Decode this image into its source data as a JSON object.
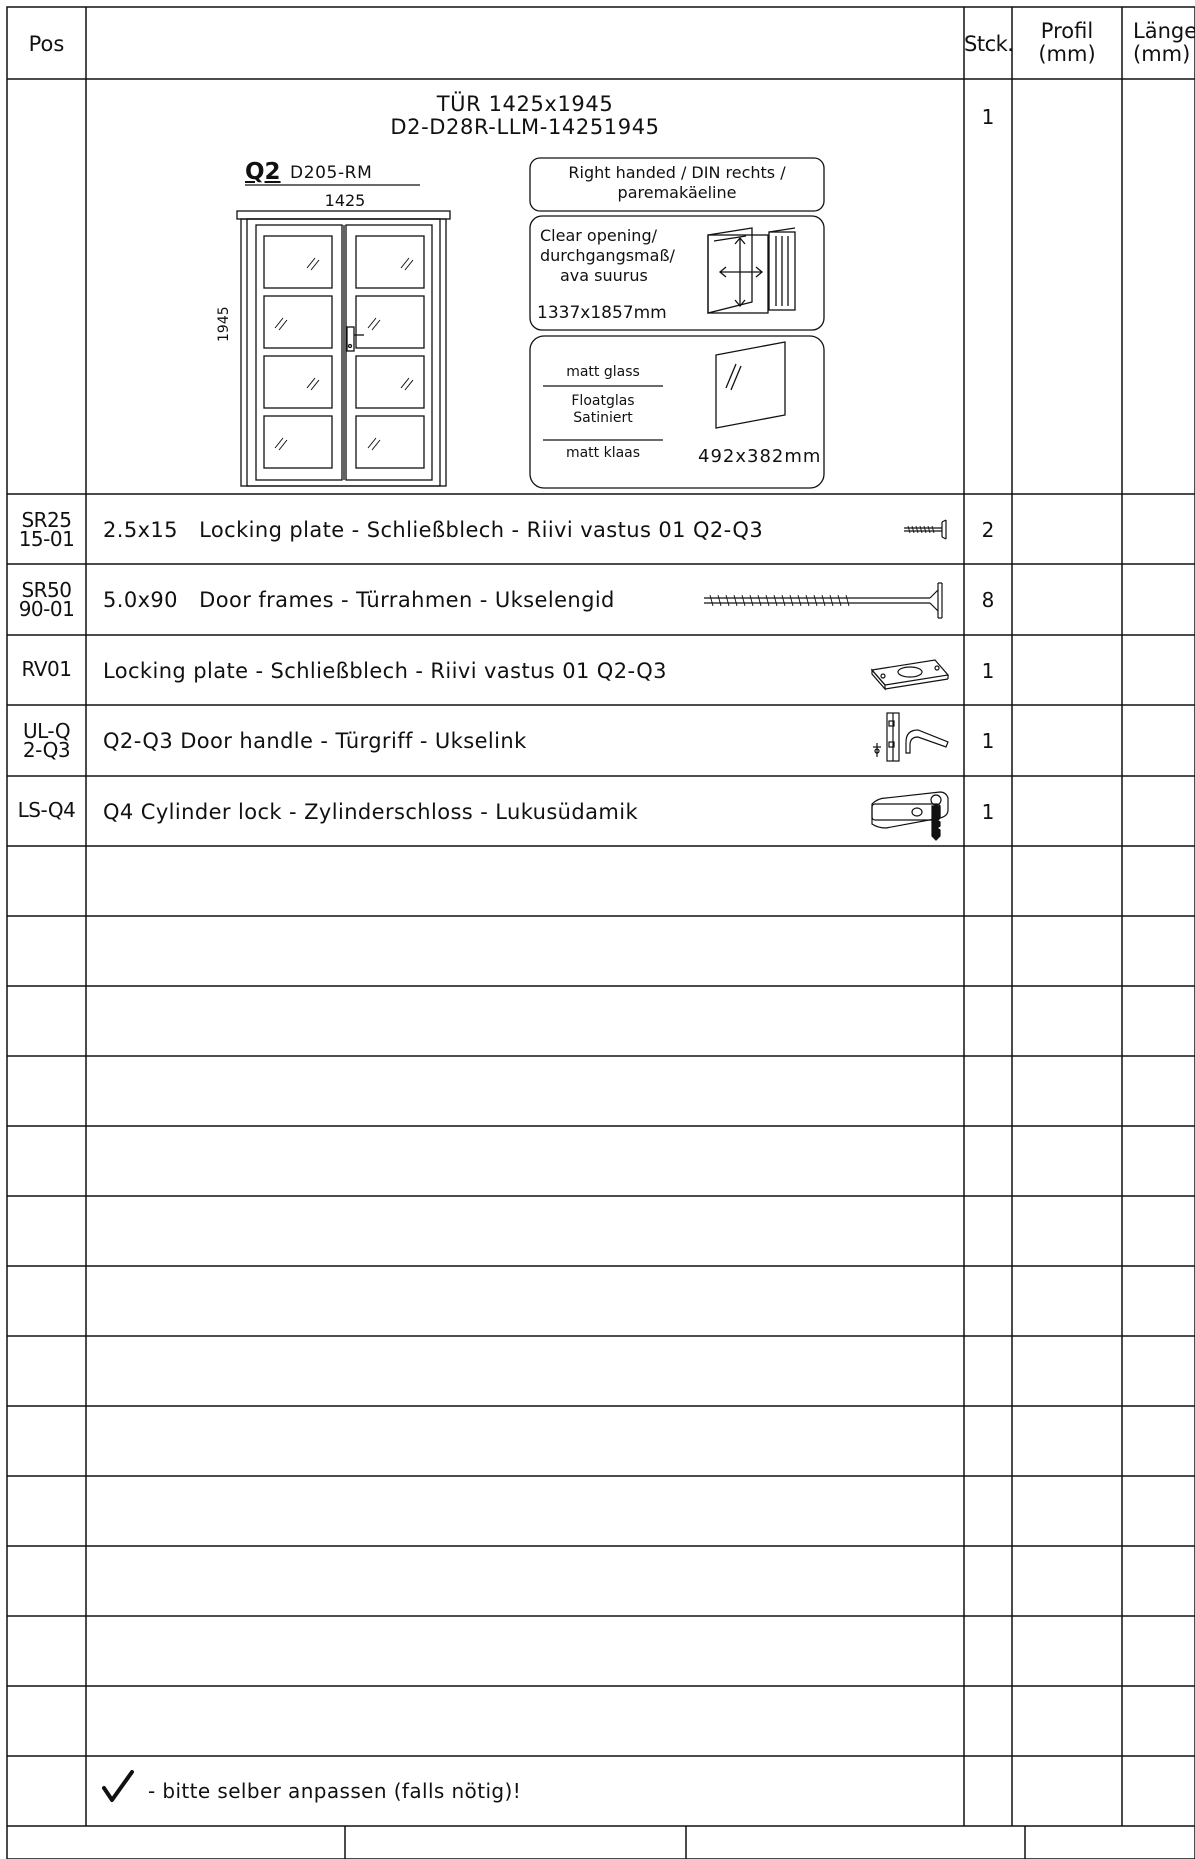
{
  "header": {
    "pos": "Pos",
    "qty": "Stck.",
    "profile_line1": "Profil",
    "profile_line2": "(mm)",
    "length_line1": "Länge",
    "length_line2": "(mm)"
  },
  "door": {
    "title_line1": "TÜR 1425x1945",
    "title_line2": "D2-D28R-LLM-14251945",
    "qty": "1",
    "model": "Q2",
    "model_code": "D205-RM",
    "width": "1425",
    "height": "1945",
    "handed": "Right handed / DIN rechts / paremakäeline",
    "clear_opening": {
      "line1": "Clear opening/",
      "line2": "durchgangsmaß/",
      "line3": "ava suurus",
      "value": "1337x1857mm"
    },
    "glass": {
      "en": "matt glass",
      "de_line1": "Floatglas",
      "de_line2": "Satiniert",
      "et": "matt klaas",
      "size": "492x382mm"
    }
  },
  "parts": [
    {
      "pos_line1": "SR25",
      "pos_line2": "15-01",
      "desc": "2.5x15   Locking plate - Schließblech - Riivi vastus 01 Q2-Q3",
      "qty": "2",
      "icon": "short-screw-icon"
    },
    {
      "pos_line1": "SR50",
      "pos_line2": "90-01",
      "desc": "5.0x90   Door frames - Türrahmen - Ukselengid",
      "qty": "8",
      "icon": "long-screw-icon"
    },
    {
      "pos_line1": "RV01",
      "pos_line2": "",
      "desc": "Locking plate - Schließblech - Riivi vastus 01 Q2-Q3",
      "qty": "1",
      "icon": "strike-plate-icon"
    },
    {
      "pos_line1": "UL-Q",
      "pos_line2": "2-Q3",
      "desc": "Q2-Q3 Door handle - Türgriff - Ukselink",
      "qty": "1",
      "icon": "door-handle-icon"
    },
    {
      "pos_line1": "LS-Q4",
      "pos_line2": "",
      "desc": "Q4 Cylinder lock - Zylinderschloss - Lukusüdamik",
      "qty": "1",
      "icon": "cylinder-lock-icon"
    }
  ],
  "footer_note": "- bitte selber anpassen (falls nötig)!"
}
